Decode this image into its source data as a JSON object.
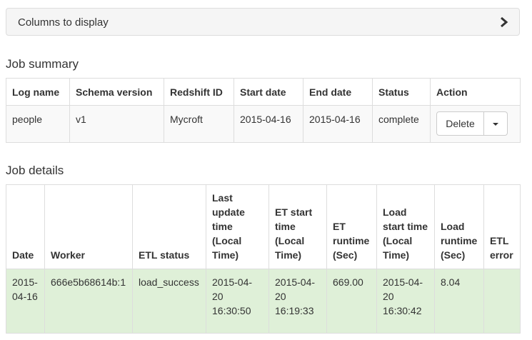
{
  "columns_panel": {
    "title": "Columns to display"
  },
  "summary": {
    "heading": "Job summary",
    "headers": [
      "Log name",
      "Schema version",
      "Redshift ID",
      "Start date",
      "End date",
      "Status",
      "Action"
    ],
    "row": {
      "log_name": "people",
      "schema_version": "v1",
      "redshift_id": "Mycroft",
      "start_date": "2015-04-16",
      "end_date": "2015-04-16",
      "status": "complete",
      "action_label": "Delete"
    }
  },
  "details": {
    "heading": "Job details",
    "headers": [
      "Date",
      "Worker",
      "ETL status",
      "Last update time (Local Time)",
      "ET start time (Local Time)",
      "ET runtime (Sec)",
      "Load start time (Local Time)",
      "Load runtime (Sec)",
      "ETL error"
    ],
    "row": {
      "date": "2015-04-16",
      "worker": "666e5b68614b:1",
      "etl_status": "load_success",
      "last_update": "2015-04-20 16:30:50",
      "et_start": "2015-04-20 16:19:33",
      "et_runtime": "669.00",
      "load_start": "2015-04-20 16:30:42",
      "load_runtime": "8.04",
      "etl_error": ""
    },
    "row_color": "#dff0d8"
  },
  "icons": {
    "panel_toggle": "chevron-right-icon",
    "action_menu": "caret-down-icon"
  }
}
